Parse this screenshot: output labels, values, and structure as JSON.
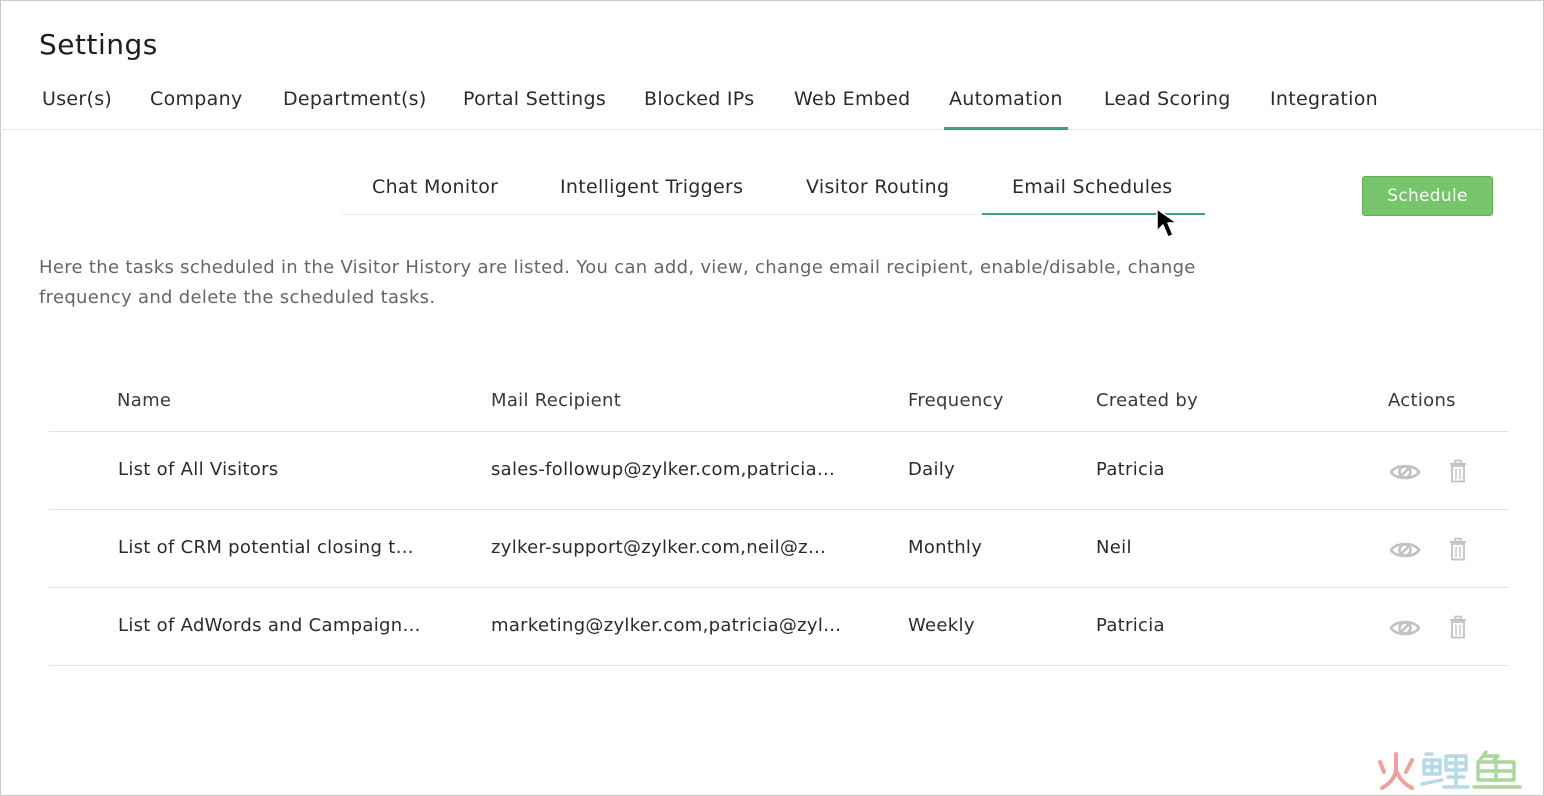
{
  "page": {
    "title": "Settings"
  },
  "main_tabs": [
    {
      "label": "User(s)"
    },
    {
      "label": "Company"
    },
    {
      "label": "Department(s)"
    },
    {
      "label": "Portal Settings"
    },
    {
      "label": "Blocked IPs"
    },
    {
      "label": "Web Embed"
    },
    {
      "label": "Automation",
      "active": true
    },
    {
      "label": "Lead Scoring"
    },
    {
      "label": "Integration"
    }
  ],
  "sub_tabs": [
    {
      "label": "Chat Monitor"
    },
    {
      "label": "Intelligent Triggers"
    },
    {
      "label": "Visitor Routing"
    },
    {
      "label": "Email Schedules",
      "active": true
    }
  ],
  "toolbar": {
    "schedule_label": "Schedule"
  },
  "description": "Here the tasks scheduled in the Visitor History are listed. You can add, view, change email recipient, enable/disable, change frequency and delete the scheduled tasks.",
  "table": {
    "headers": {
      "name": "Name",
      "mail": "Mail Recipient",
      "frequency": "Frequency",
      "created_by": "Created by",
      "actions": "Actions"
    },
    "rows": [
      {
        "name": "List of All Visitors",
        "mail": "sales-followup@zylker.com,patricia…",
        "frequency": "Daily",
        "created_by": "Patricia"
      },
      {
        "name": "List of CRM potential closing t…",
        "mail": "zylker-support@zylker.com,neil@z…",
        "frequency": "Monthly",
        "created_by": "Neil"
      },
      {
        "name": "List of AdWords and Campaign…",
        "mail": "marketing@zylker.com,patricia@zyl…",
        "frequency": "Weekly",
        "created_by": "Patricia"
      }
    ]
  },
  "icons": {
    "view": "eye-slash-icon",
    "delete": "trash-icon",
    "cursor": "mouse-pointer-icon",
    "watermark": "watermark-logo"
  },
  "colors": {
    "accent": "#3ba57a",
    "button": "#77c56a",
    "muted_text": "#666666",
    "icon_gray": "#c2c2c2",
    "watermark": "#f2a09a"
  }
}
